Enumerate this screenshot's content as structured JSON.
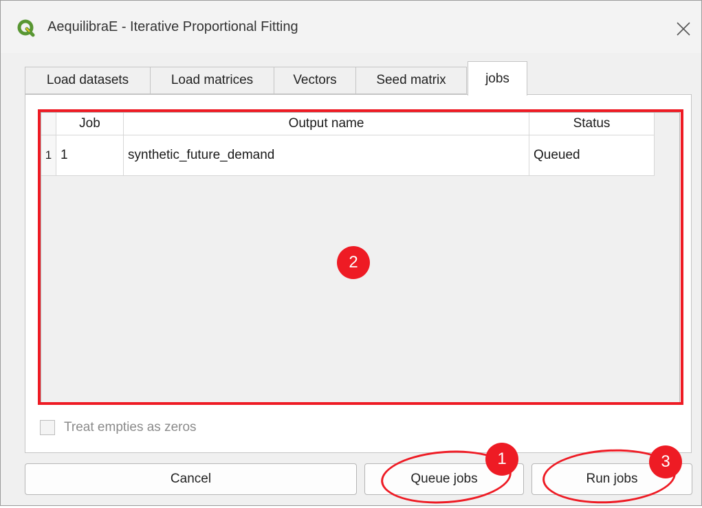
{
  "window": {
    "title": "AequilibraE - Iterative Proportional Fitting"
  },
  "tabs": [
    {
      "label": "Load datasets"
    },
    {
      "label": "Load matrices"
    },
    {
      "label": "Vectors"
    },
    {
      "label": "Seed matrix"
    },
    {
      "label": "jobs",
      "active": true
    }
  ],
  "jobs_table": {
    "columns": [
      "Job",
      "Output name",
      "Status"
    ],
    "rows": [
      {
        "index": "1",
        "job": "1",
        "output_name": "synthetic_future_demand",
        "status": "Queued"
      }
    ]
  },
  "options": {
    "treat_empties_label": "Treat empties as zeros",
    "treat_empties_checked": false
  },
  "buttons": {
    "cancel": "Cancel",
    "queue_jobs": "Queue jobs",
    "run_jobs": "Run jobs"
  },
  "annotations": {
    "badge_1": "1",
    "badge_2": "2",
    "badge_3": "3"
  },
  "colors": {
    "annotation_red": "#ee1b24",
    "app_icon_green": "#589632"
  },
  "icons": {
    "app": "qgis-logo-icon",
    "close": "close-icon"
  }
}
